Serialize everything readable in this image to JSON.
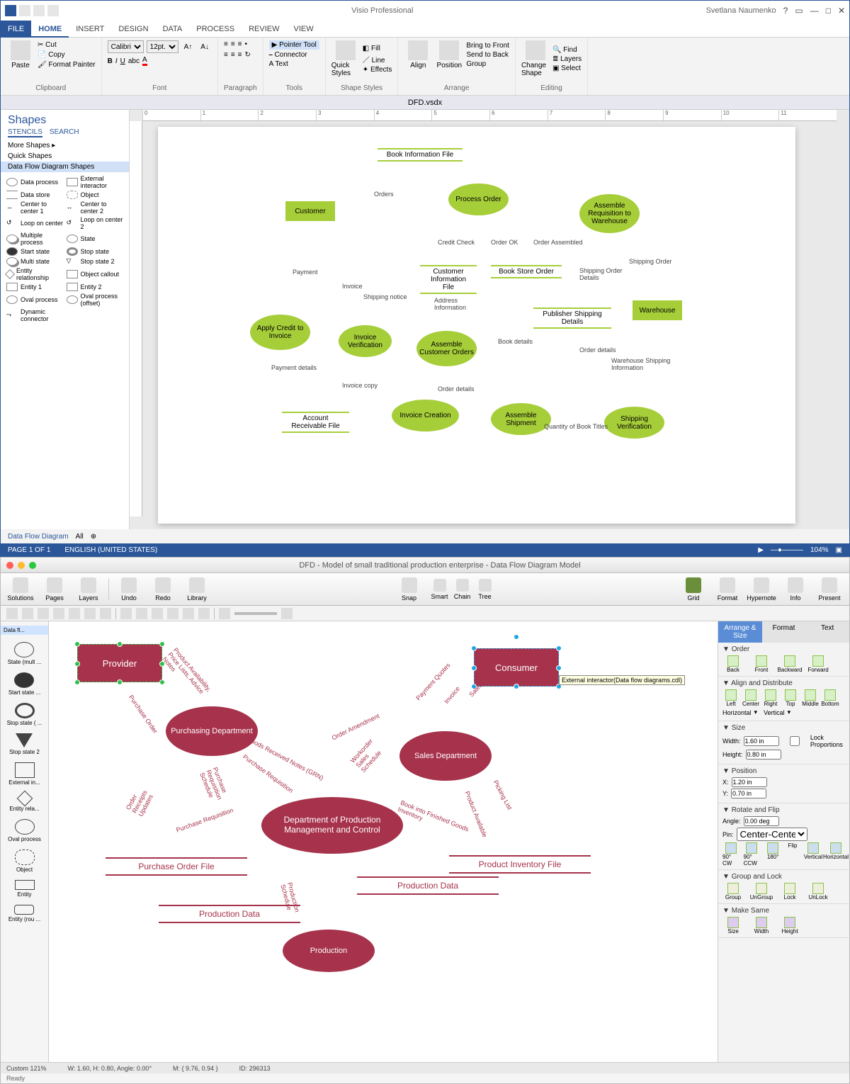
{
  "visio": {
    "app_title": "Visio Professional",
    "user": "Svetlana Naumenko",
    "tabs": [
      "FILE",
      "HOME",
      "INSERT",
      "DESIGN",
      "DATA",
      "PROCESS",
      "REVIEW",
      "VIEW"
    ],
    "active_tab": "HOME",
    "doc": "DFD.vsdx",
    "ribbon": {
      "paste": "Paste",
      "cut": "Cut",
      "copy": "Copy",
      "format_painter": "Format Painter",
      "clipboard": "Clipboard",
      "font_name": "Calibri",
      "font_size": "12pt.",
      "font": "Font",
      "paragraph": "Paragraph",
      "tools": "Tools",
      "pointer": "Pointer Tool",
      "connector": "Connector",
      "atext": "A Text",
      "shape_styles": "Shape Styles",
      "quick_styles": "Quick Styles",
      "fill": "Fill",
      "line": "Line",
      "effects": "Effects",
      "align": "Align",
      "position": "Position",
      "bring_front": "Bring to Front",
      "send_back": "Send to Back",
      "group": "Group",
      "arrange": "Arrange",
      "change_shape": "Change Shape",
      "find": "Find",
      "layers": "Layers",
      "select": "Select",
      "editing": "Editing"
    },
    "shapes_panel": {
      "title": "Shapes",
      "stencils": "STENCILS",
      "search": "SEARCH",
      "more": "More Shapes",
      "quick": "Quick Shapes",
      "category": "Data Flow Diagram Shapes",
      "items": [
        [
          "Data process",
          "External interactor"
        ],
        [
          "Data store",
          "Object"
        ],
        [
          "Center to center 1",
          "Center to center 2"
        ],
        [
          "Loop on center",
          "Loop on center 2"
        ],
        [
          "Multiple process",
          "State"
        ],
        [
          "Start state",
          "Stop state"
        ],
        [
          "Multi state",
          "Stop state 2"
        ],
        [
          "Entity relationship",
          "Object callout"
        ],
        [
          "Entity 1",
          "Entity 2"
        ],
        [
          "Oval process",
          "Oval process (offset)"
        ],
        [
          "Dynamic connector",
          ""
        ]
      ]
    },
    "page_tab": "Data Flow Diagram",
    "all": "All",
    "status": {
      "page": "PAGE 1 OF 1",
      "lang": "ENGLISH (UNITED STATES)",
      "zoom": "104%"
    },
    "dfd": {
      "externals": {
        "customer": "Customer",
        "warehouse": "Warehouse"
      },
      "processes": {
        "process_order": "Process Order",
        "apply_credit": "Apply Credit to Invoice",
        "invoice_verif": "Invoice Verification",
        "assemble_cust": "Assemble Customer Orders",
        "invoice_creation": "Invoice Creation",
        "assemble_ship": "Assemble Shipment",
        "shipping_verif": "Shipping Verification",
        "assemble_req": "Assemble Requisition to Warehouse"
      },
      "stores": {
        "book_info": "Book Information File",
        "cust_info": "Customer Information File",
        "book_store_order": "Book Store Order",
        "pub_ship": "Publisher Shipping Details",
        "account_recv": "Account Receivable File"
      },
      "flows": {
        "orders": "Orders",
        "credit_check": "Credit Check",
        "order_ok": "Order OK",
        "order_assembled": "Order Assembled",
        "shipping_order": "Shipping Order",
        "shipping_order_details": "Shipping Order Details",
        "payment": "Payment",
        "invoice": "Invoice",
        "shipping_notice": "Shipping notice",
        "address_info": "Address Information",
        "book_details": "Book details",
        "order_details": "Order details",
        "warehouse_ship_info": "Warehouse Shipping Information",
        "payment_details": "Payment details",
        "invoice_copy": "Invoice copy",
        "order_details2": "Order details",
        "qty_titles": "Quantity of Book Titles"
      }
    }
  },
  "mac": {
    "title": "DFD - Model of small traditional production enterprise - Data Flow Diagram Model",
    "toolbar": {
      "solutions": "Solutions",
      "pages": "Pages",
      "layers": "Layers",
      "undo": "Undo",
      "redo": "Redo",
      "library": "Library",
      "snap": "Snap",
      "smart": "Smart",
      "chain": "Chain",
      "tree": "Tree",
      "grid": "Grid",
      "format": "Format",
      "hypernote": "Hypernote",
      "info": "Info",
      "present": "Present"
    },
    "stencil": {
      "lib": "Data fl...",
      "items": [
        "State (mult ...",
        "Start state ...",
        "Stop state ( ...",
        "Stop state 2",
        "External in...",
        "Entity rela...",
        "Oval process",
        "Object",
        "Entity",
        "Entity (rou ..."
      ]
    },
    "panel": {
      "tab_arrange": "Arrange & Size",
      "tab_format": "Format",
      "tab_text": "Text",
      "order": "Order",
      "back": "Back",
      "front": "Front",
      "backward": "Backward",
      "forward": "Forward",
      "align_dist": "Align and Distribute",
      "align_left": "Left",
      "align_center": "Center",
      "align_right": "Right",
      "align_top": "Top",
      "align_middle": "Middle",
      "align_bottom": "Bottom",
      "dist_h": "Horizontal",
      "dist_v": "Vertical",
      "size": "Size",
      "width": "Width:",
      "width_v": "1.60 in",
      "height": "Height:",
      "height_v": "0.80 in",
      "lock_prop": "Lock Proportions",
      "position": "Position",
      "x": "X:",
      "x_v": "1.20 in",
      "y": "Y:",
      "y_v": "0.70 in",
      "rotate": "Rotate and Flip",
      "angle": "Angle:",
      "angle_v": "0.00 deg",
      "pin": "Pin:",
      "pin_v": "Center-Center",
      "r90cw": "90° CW",
      "r90ccw": "90° CCW",
      "r180": "180°",
      "flip": "Flip",
      "flip_v": "Vertical",
      "flip_h": "Horizontal",
      "group_lock": "Group and Lock",
      "group": "Group",
      "ungroup": "UnGroup",
      "lock": "Lock",
      "unlock": "UnLock",
      "make_same": "Make Same",
      "ms_size": "Size",
      "ms_width": "Width",
      "ms_height": "Height"
    },
    "tooltip": "External interactor(Data flow diagrams.cdl)",
    "dfd": {
      "externals": {
        "provider": "Provider",
        "consumer": "Consumer"
      },
      "processes": {
        "purch": "Purchasing Department",
        "sales": "Sales Department",
        "dpm": "Department of Production Management and Control",
        "prod": "Production"
      },
      "stores": {
        "po_file": "Purchase Order File",
        "prod_data1": "Production Data",
        "prod_data2": "Production Data",
        "inv_file": "Product Inventory File"
      },
      "flows": {
        "po": "Purchase Order",
        "avail": "Product Availability, Price Lists, Advice Notes",
        "grn": "Goods Received Notes (GRN)",
        "preq": "Purchase Requisition",
        "preq_sched": "Purchase Requisition Schedule",
        "order_amend": "Order Amendment",
        "wo_sched": "Workorder Sales Schedule",
        "quotes": "Payment  Quotes",
        "invoice": "Invoice",
        "sales_order": "Sales Order",
        "picking": "Picking List",
        "prod_avail": "Product Available",
        "book_finished": "Book into Finished Goods Inventory",
        "receipts": "Order Receipts Updates",
        "preq2": "Purchase Requisition",
        "prod_sched": "Production Schedule"
      }
    },
    "status": {
      "zoom": "Custom 121%",
      "wh": "W: 1.60, H: 0.80, Angle: 0.00°",
      "m": "M: { 9.76, 0.94 }",
      "id": "ID: 296313",
      "ready": "Ready"
    }
  }
}
